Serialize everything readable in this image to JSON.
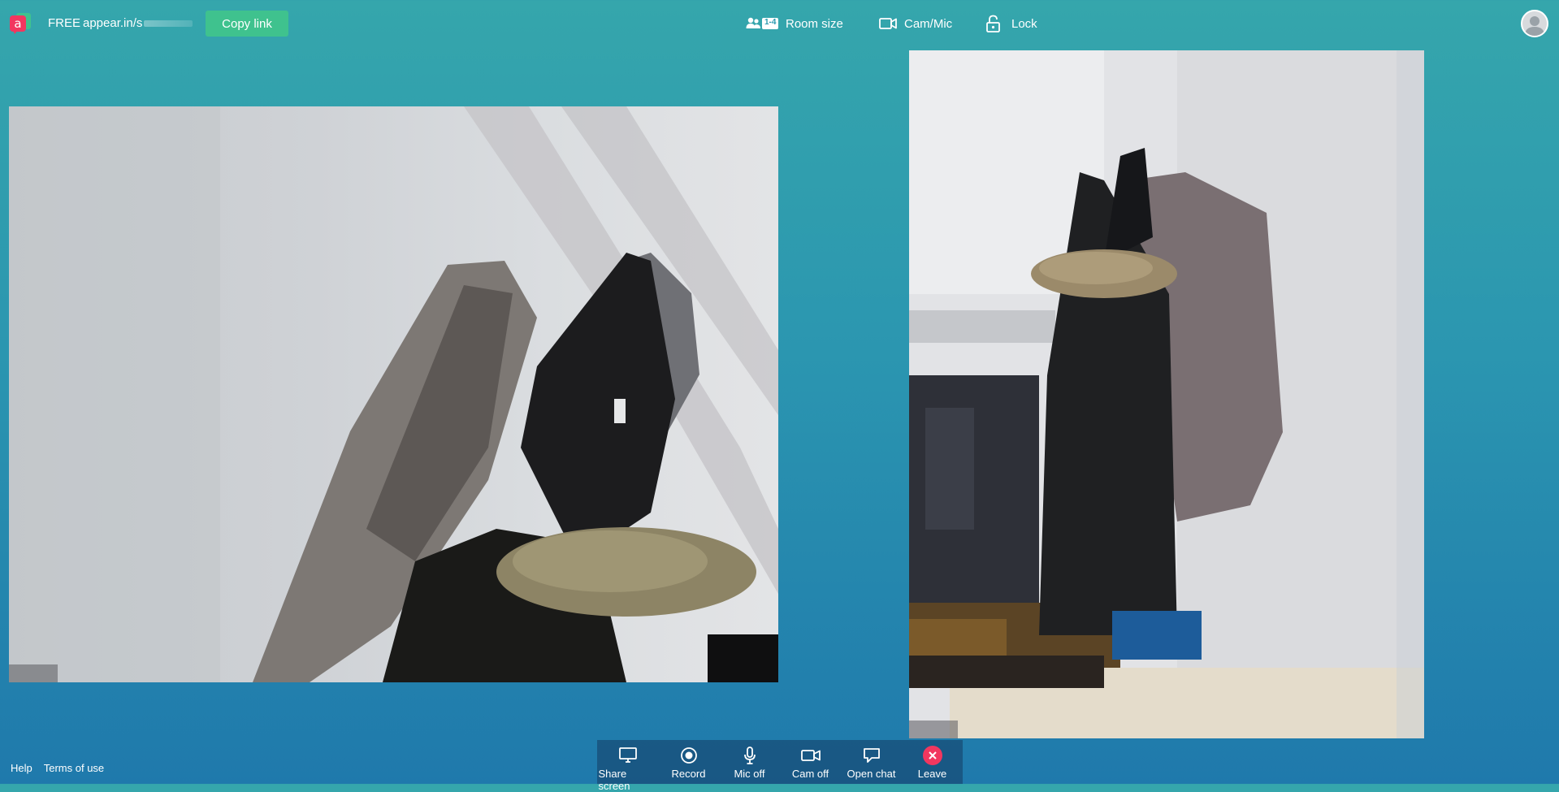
{
  "header": {
    "plan": "FREE",
    "room_url": "appear.in/s",
    "copy_link": "Copy link",
    "actions": {
      "room_size": "Room size",
      "room_size_badge": "1-4",
      "cam_mic": "Cam/Mic",
      "lock": "Lock"
    }
  },
  "footer": {
    "help": "Help",
    "terms": "Terms of use"
  },
  "controls": {
    "share_screen": "Share screen",
    "record": "Record",
    "mic_off": "Mic off",
    "cam_off": "Cam off",
    "open_chat": "Open chat",
    "leave": "Leave"
  },
  "colors": {
    "brand_pink": "#f2375f",
    "copy_button": "#3fc28e",
    "background_top": "#35a6ac",
    "background_bottom": "#1f79ac"
  }
}
